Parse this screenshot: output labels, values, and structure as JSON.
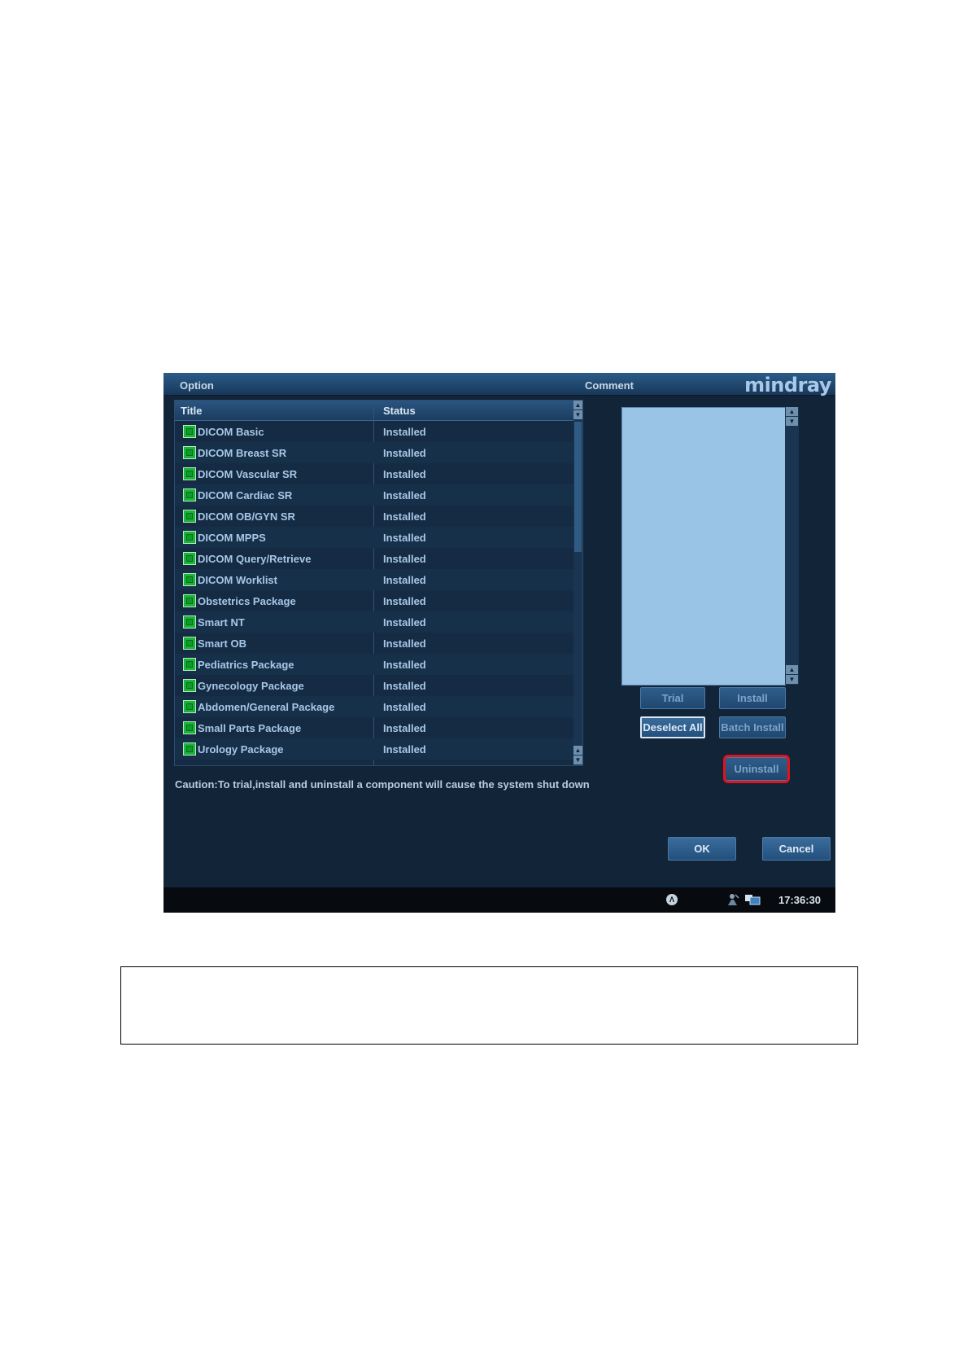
{
  "window": {
    "option_label": "Option",
    "comment_label": "Comment",
    "logo": "mindray"
  },
  "table": {
    "columns": [
      "Title",
      "Status"
    ],
    "rows": [
      {
        "title": "DICOM Basic",
        "status": "Installed"
      },
      {
        "title": "DICOM Breast SR",
        "status": "Installed"
      },
      {
        "title": "DICOM Vascular SR",
        "status": "Installed"
      },
      {
        "title": "DICOM Cardiac SR",
        "status": "Installed"
      },
      {
        "title": "DICOM OB/GYN SR",
        "status": "Installed"
      },
      {
        "title": "DICOM MPPS",
        "status": "Installed"
      },
      {
        "title": "DICOM Query/Retrieve",
        "status": "Installed"
      },
      {
        "title": "DICOM Worklist",
        "status": "Installed"
      },
      {
        "title": "Obstetrics Package",
        "status": "Installed"
      },
      {
        "title": "Smart NT",
        "status": "Installed"
      },
      {
        "title": "Smart OB",
        "status": "Installed"
      },
      {
        "title": "Pediatrics Package",
        "status": "Installed"
      },
      {
        "title": "Gynecology Package",
        "status": "Installed"
      },
      {
        "title": "Abdomen/General Package",
        "status": "Installed"
      },
      {
        "title": "Small Parts Package",
        "status": "Installed"
      },
      {
        "title": "Urology Package",
        "status": "Installed"
      }
    ]
  },
  "buttons": {
    "trial": "Trial",
    "install": "Install",
    "deselect_all": "Deselect All",
    "batch_install": "Batch Install",
    "uninstall": "Uninstall",
    "ok": "OK",
    "cancel": "Cancel"
  },
  "caution": "Caution:To trial,install and uninstall a component will cause the system shut down",
  "taskbar": {
    "clock": "17:36:30"
  },
  "colors": {
    "highlight": "#e3111c",
    "background": "#122438"
  }
}
